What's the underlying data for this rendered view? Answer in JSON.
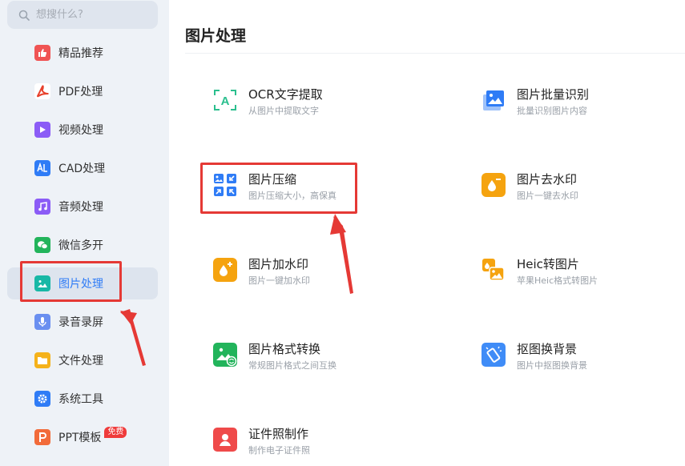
{
  "search": {
    "placeholder": "想搜什么?"
  },
  "sidebar": {
    "items": [
      {
        "label": "精品推荐",
        "icon": "thumbs-up-icon",
        "color": "#f05454"
      },
      {
        "label": "PDF处理",
        "icon": "pdf-icon",
        "color": "#ffffff"
      },
      {
        "label": "视频处理",
        "icon": "play-icon",
        "color": "#8b5cf6"
      },
      {
        "label": "CAD处理",
        "icon": "cad-icon",
        "color": "#2f7cf6"
      },
      {
        "label": "音频处理",
        "icon": "music-icon",
        "color": "#8b5cf6"
      },
      {
        "label": "微信多开",
        "icon": "wechat-icon",
        "color": "#22b45b"
      },
      {
        "label": "图片处理",
        "icon": "image-icon",
        "color": "#18b8a6",
        "active": true
      },
      {
        "label": "录音录屏",
        "icon": "microphone-icon",
        "color": "#6a8ff0"
      },
      {
        "label": "文件处理",
        "icon": "folder-icon",
        "color": "#f5b21b"
      },
      {
        "label": "系统工具",
        "icon": "gear-icon",
        "color": "#2f7cf6"
      },
      {
        "label": "PPT模板",
        "icon": "ppt-icon",
        "color": "#f26b3a",
        "badge": "免费"
      }
    ]
  },
  "main": {
    "title": "图片处理",
    "tools": [
      {
        "name": "OCR文字提取",
        "desc": "从图片中提取文字",
        "icon": "ocr-icon"
      },
      {
        "name": "图片批量识别",
        "desc": "批量识别图片内容",
        "icon": "batch-image-icon"
      },
      {
        "name": "图片压缩",
        "desc": "图片压缩大小，高保真",
        "icon": "compress-icon"
      },
      {
        "name": "图片去水印",
        "desc": "图片一键去水印",
        "icon": "remove-watermark-icon"
      },
      {
        "name": "图片加水印",
        "desc": "图片一键加水印",
        "icon": "add-watermark-icon"
      },
      {
        "name": "Heic转图片",
        "desc": "苹果Heic格式转图片",
        "icon": "heic-icon"
      },
      {
        "name": "图片格式转换",
        "desc": "常规图片格式之间互换",
        "icon": "format-convert-icon"
      },
      {
        "name": "抠图换背景",
        "desc": "图片中抠图换背景",
        "icon": "cutout-icon"
      },
      {
        "name": "证件照制作",
        "desc": "制作电子证件照",
        "icon": "id-photo-icon"
      }
    ]
  },
  "colors": {
    "accent": "#2f7cf6",
    "annotation": "#e53935",
    "sidebar_bg": "#eef2f7"
  }
}
